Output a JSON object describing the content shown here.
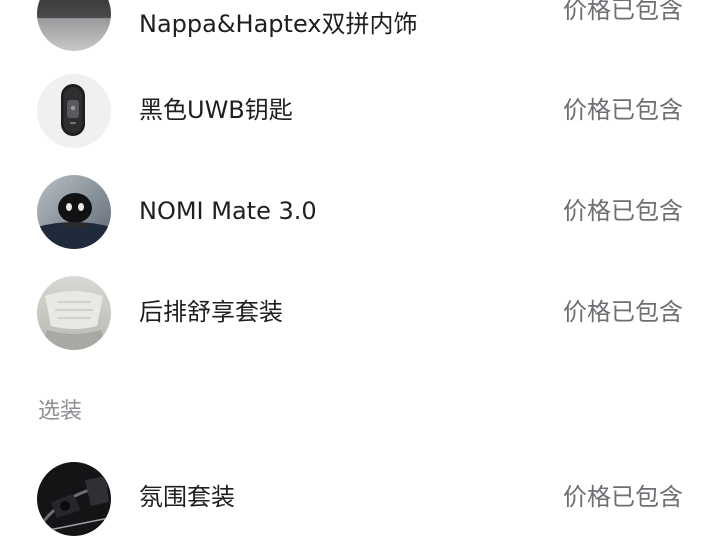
{
  "included_items": [
    {
      "name": "Nappa&Haptex双拼内饰",
      "price": "价格已包含",
      "icon": "interior-seat-icon"
    },
    {
      "name": "黑色UWB钥匙",
      "price": "价格已包含",
      "icon": "car-key-icon"
    },
    {
      "name": "NOMI Mate 3.0",
      "price": "价格已包含",
      "icon": "nomi-robot-icon"
    },
    {
      "name": "后排舒享套装",
      "price": "价格已包含",
      "icon": "rear-seat-icon"
    }
  ],
  "optional_section": {
    "label": "选装",
    "items": [
      {
        "name": "氛围套装",
        "price": "价格已包含",
        "icon": "ambient-light-icon"
      }
    ]
  }
}
